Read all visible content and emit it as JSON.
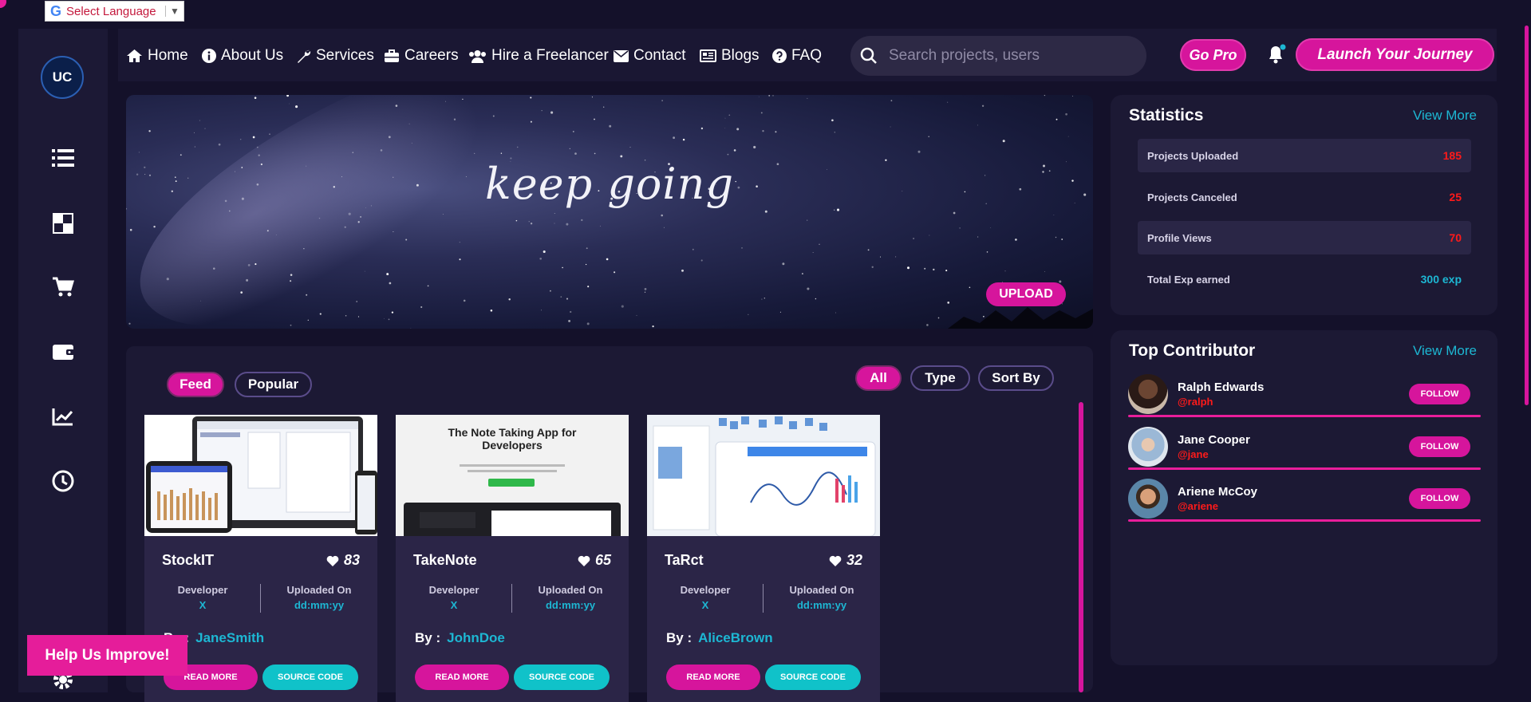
{
  "translate": {
    "label": "Select Language",
    "g": "G",
    "arrow": "▼"
  },
  "logo": {
    "text": "UC"
  },
  "nav": {
    "items": [
      {
        "label": "Home",
        "icon": "home-icon"
      },
      {
        "label": "About Us",
        "icon": "info-icon"
      },
      {
        "label": "Services",
        "icon": "wrench-icon"
      },
      {
        "label": "Careers",
        "icon": "briefcase-icon"
      },
      {
        "label": "Hire a Freelancer",
        "icon": "users-icon"
      },
      {
        "label": "Contact",
        "icon": "envelope-icon"
      },
      {
        "label": "Blogs",
        "icon": "newspaper-icon"
      },
      {
        "label": "FAQ",
        "icon": "question-icon"
      }
    ],
    "search_placeholder": "Search projects, users",
    "go_pro": "Go Pro",
    "launch": "Launch Your Journey"
  },
  "sidebar": {
    "icons": [
      "list-icon",
      "dashboard-icon",
      "cart-icon",
      "wallet-icon",
      "chart-icon",
      "history-icon",
      "gear-icon"
    ]
  },
  "banner": {
    "text": "keep going",
    "upload": "UPLOAD"
  },
  "feed": {
    "tabs": [
      "Feed",
      "Popular"
    ],
    "filters": [
      "All",
      "Type",
      "Sort By"
    ],
    "cards": [
      {
        "title": "StockIT",
        "likes": "83",
        "dev_label": "Developer",
        "dev": "X",
        "up_label": "Uploaded On",
        "up": "dd:mm:yy",
        "by": "By :",
        "author": "JaneSmith",
        "read": "READ MORE",
        "source": "SOURCE CODE"
      },
      {
        "title": "TakeNote",
        "likes": "65",
        "dev_label": "Developer",
        "dev": "X",
        "up_label": "Uploaded On",
        "up": "dd:mm:yy",
        "by": "By :",
        "author": "JohnDoe",
        "read": "READ MORE",
        "source": "SOURCE CODE",
        "thumb_title": "The Note Taking App for Developers"
      },
      {
        "title": "TaRct",
        "likes": "32",
        "dev_label": "Developer",
        "dev": "X",
        "up_label": "Uploaded On",
        "up": "dd:mm:yy",
        "by": "By :",
        "author": "AliceBrown",
        "read": "READ MORE",
        "source": "SOURCE CODE"
      }
    ]
  },
  "stats": {
    "title": "Statistics",
    "view_more": "View More",
    "rows": [
      {
        "label": "Projects Uploaded",
        "value": "185"
      },
      {
        "label": "Projects Canceled",
        "value": "25"
      },
      {
        "label": "Profile Views",
        "value": "70"
      },
      {
        "label": "Total Exp earned",
        "value": "300 exp"
      }
    ]
  },
  "contributors": {
    "title": "Top Contributor",
    "view_more": "View More",
    "list": [
      {
        "name": "Ralph Edwards",
        "handle": "@ralph",
        "follow": "FOLLOW"
      },
      {
        "name": "Jane Cooper",
        "handle": "@jane",
        "follow": "FOLLOW"
      },
      {
        "name": "Ariene McCoy",
        "handle": "@ariene",
        "follow": "FOLLOW"
      }
    ]
  },
  "help": "Help Us Improve!"
}
